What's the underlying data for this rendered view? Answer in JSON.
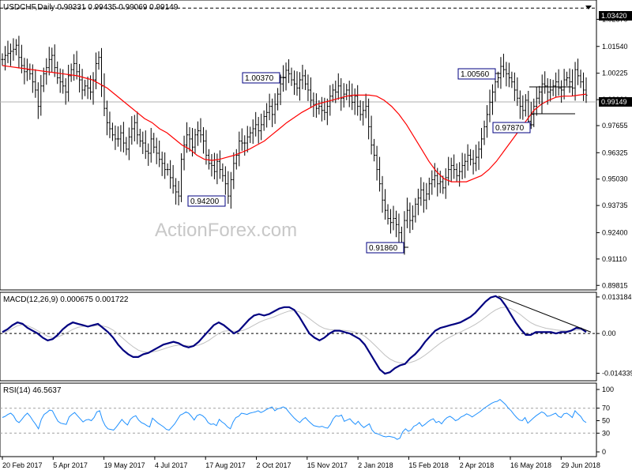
{
  "header": {
    "symbol_line": "USDCHF,Daily  0.99331 0.99435 0.99069 0.99149",
    "macd_label": "MACD(12,26,9) 0.000675 0.001722",
    "rsi_label": "RSI(14) 46.5637"
  },
  "watermark": "ActionForex.com",
  "colors": {
    "price": "#000000",
    "ma": "#ff0000",
    "macd": "#000080",
    "signal": "#c0c0c0",
    "rsi": "#1e90ff",
    "annotation_box": "#000080",
    "current_price_label_bg": "#000000"
  },
  "chart_data": [
    {
      "type": "ohlc",
      "name": "price",
      "y_ticks": [
        "1.03420",
        "1.02870",
        "1.01540",
        "1.00225",
        "0.99149",
        "0.98930",
        "0.97655",
        "0.96325",
        "0.95030",
        "0.93735",
        "0.92400",
        "0.91110",
        "0.89815"
      ],
      "ylim": [
        0.8967,
        1.0374
      ],
      "current_price": "0.99149",
      "resistance_level": 1.0342,
      "x_ticks": [
        "20 Feb 2017",
        "5 Apr 2017",
        "19 May 2017",
        "4 Jul 2017",
        "17 Aug 2017",
        "2 Oct 2017",
        "15 Nov 2017",
        "2 Jan 2018",
        "15 Feb 2018",
        "2 Apr 2018",
        "16 May 2018",
        "29 Jun 2018"
      ],
      "close_path": [
        1.009,
        1.011,
        1.012,
        1.013,
        1.014,
        1.016,
        1.01,
        1.006,
        1.003,
        1.004,
        1.002,
        0.998,
        0.994,
        0.986,
        0.996,
        1.002,
        1.005,
        1.009,
        1.011,
        1.005,
        1.0,
        0.998,
        0.996,
        0.993,
        1.001,
        1.004,
        1.007,
        1.003,
        0.999,
        0.994,
        0.996,
        0.995,
        0.993,
        0.999,
        1.007,
        1.01,
        0.996,
        0.985,
        0.978,
        0.975,
        0.972,
        0.97,
        0.97,
        0.973,
        0.968,
        0.965,
        0.971,
        0.975,
        0.978,
        0.972,
        0.969,
        0.968,
        0.964,
        0.963,
        0.97,
        0.966,
        0.963,
        0.96,
        0.958,
        0.955,
        0.955,
        0.951,
        0.947,
        0.944,
        0.942,
        0.96,
        0.967,
        0.972,
        0.97,
        0.966,
        0.972,
        0.974,
        0.972,
        0.969,
        0.962,
        0.958,
        0.957,
        0.954,
        0.959,
        0.955,
        0.952,
        0.948,
        0.942,
        0.95,
        0.958,
        0.962,
        0.969,
        0.968,
        0.968,
        0.971,
        0.973,
        0.975,
        0.977,
        0.974,
        0.977,
        0.981,
        0.983,
        0.986,
        0.982,
        0.987,
        0.992,
        0.997,
        1.0,
        1.0037,
        1.002,
        0.999,
        0.997,
        0.995,
        0.999,
        1.001,
        0.997,
        0.994,
        0.989,
        0.987,
        0.985,
        0.986,
        0.984,
        0.983,
        0.986,
        0.991,
        0.994,
        0.993,
        0.996,
        0.99,
        0.992,
        0.994,
        0.991,
        0.988,
        0.991,
        0.986,
        0.982,
        0.984,
        0.986,
        0.976,
        0.967,
        0.962,
        0.955,
        0.948,
        0.94,
        0.935,
        0.931,
        0.929,
        0.931,
        0.928,
        0.924,
        0.9186,
        0.93,
        0.935,
        0.93,
        0.932,
        0.938,
        0.941,
        0.945,
        0.94,
        0.943,
        0.948,
        0.95,
        0.952,
        0.948,
        0.949,
        0.946,
        0.951,
        0.955,
        0.957,
        0.955,
        0.952,
        0.954,
        0.957,
        0.959,
        0.962,
        0.96,
        0.958,
        0.961,
        0.965,
        0.97,
        0.976,
        0.982,
        0.988,
        0.993,
        0.998,
        1.0,
        1.0056,
        1.004,
        1.002,
        1.0,
        0.998,
        0.994,
        0.99,
        0.986,
        0.984,
        0.989,
        0.9787,
        0.982,
        0.986,
        0.99,
        0.993,
        0.997,
        0.996,
        0.993,
        0.994,
        0.996,
        0.998,
        0.995,
        0.994,
        0.999,
        1.0,
        0.998,
        0.995,
        1.004,
        1.001,
        0.998,
        0.994,
        0.99149
      ],
      "ma_path": [
        1.006,
        1.0055,
        1.005,
        1.0045,
        1.004,
        1.0035,
        1.003,
        1.0025,
        1.002,
        1.0015,
        1.001,
        1.0,
        0.999,
        0.997,
        0.995,
        0.992,
        0.989,
        0.986,
        0.983,
        0.98,
        0.978,
        0.975,
        0.973,
        0.97,
        0.967,
        0.965,
        0.962,
        0.96,
        0.9595,
        0.96,
        0.961,
        0.962,
        0.9635,
        0.965,
        0.967,
        0.969,
        0.972,
        0.975,
        0.978,
        0.9805,
        0.983,
        0.985,
        0.987,
        0.988,
        0.989,
        0.99,
        0.991,
        0.9915,
        0.9915,
        0.9915,
        0.991,
        0.989,
        0.986,
        0.982,
        0.977,
        0.971,
        0.965,
        0.959,
        0.954,
        0.9505,
        0.949,
        0.949,
        0.949,
        0.9505,
        0.952,
        0.955,
        0.959,
        0.964,
        0.969,
        0.974,
        0.979,
        0.984,
        0.987,
        0.989,
        0.9905,
        0.991,
        0.991,
        0.9915,
        0.992
      ]
    },
    {
      "type": "line",
      "name": "MACD",
      "y_ticks": [
        "0.013184",
        "0.00",
        "-0.014339"
      ],
      "ylim": [
        -0.0165,
        0.0143
      ],
      "zero_line": 0,
      "macd_path": [
        0.0005,
        0.0015,
        0.003,
        0.004,
        0.0035,
        0.002,
        0.001,
        0.0,
        -0.0015,
        -0.0025,
        -0.002,
        -0.0005,
        0.0015,
        0.003,
        0.004,
        0.0035,
        0.003,
        0.0025,
        0.003,
        0.0035,
        0.002,
        0.0005,
        -0.0015,
        -0.004,
        -0.006,
        -0.0075,
        -0.0085,
        -0.0085,
        -0.0075,
        -0.007,
        -0.006,
        -0.005,
        -0.004,
        -0.0035,
        -0.003,
        -0.0035,
        -0.0045,
        -0.005,
        -0.0045,
        -0.003,
        -0.001,
        0.001,
        0.003,
        0.004,
        0.003,
        0.0015,
        0.0,
        0.001,
        0.003,
        0.005,
        0.0065,
        0.007,
        0.0065,
        0.007,
        0.008,
        0.009,
        0.0095,
        0.0095,
        0.0085,
        0.006,
        0.003,
        0.0,
        -0.0015,
        -0.0025,
        -0.0015,
        0.0,
        0.001,
        0.001,
        0.0005,
        0.0,
        -0.001,
        -0.002,
        -0.004,
        -0.007,
        -0.01,
        -0.013,
        -0.0145,
        -0.014,
        -0.0125,
        -0.0115,
        -0.011,
        -0.009,
        -0.0075,
        -0.0055,
        -0.003,
        -0.001,
        0.001,
        0.002,
        0.0025,
        0.003,
        0.0035,
        0.004,
        0.005,
        0.006,
        0.0075,
        0.0095,
        0.0115,
        0.013,
        0.0135,
        0.0125,
        0.01,
        0.007,
        0.004,
        0.0015,
        -0.0005,
        -0.0005,
        0.0005,
        0.0005,
        0.0005,
        0.0005,
        0.0,
        0.0005,
        0.0005,
        0.001,
        0.002,
        0.0018,
        0.0005
      ],
      "signal_path": [
        0.0,
        0.0008,
        0.0018,
        0.0028,
        0.0032,
        0.0028,
        0.002,
        0.001,
        0.0,
        -0.001,
        -0.0015,
        -0.0012,
        -0.0005,
        0.0005,
        0.0015,
        0.0022,
        0.0026,
        0.0026,
        0.0027,
        0.0029,
        0.0027,
        0.0022,
        0.0012,
        -0.0002,
        -0.0018,
        -0.0034,
        -0.0048,
        -0.006,
        -0.0066,
        -0.0068,
        -0.0066,
        -0.0062,
        -0.0056,
        -0.005,
        -0.0045,
        -0.0042,
        -0.0042,
        -0.0044,
        -0.0045,
        -0.0042,
        -0.0035,
        -0.0025,
        -0.0012,
        0.0,
        0.0008,
        0.001,
        0.0008,
        0.0008,
        0.0012,
        0.002,
        0.003,
        0.004,
        0.0048,
        0.0054,
        0.006,
        0.0068,
        0.0075,
        0.0081,
        0.0083,
        0.0078,
        0.0068,
        0.0054,
        0.004,
        0.0027,
        0.0018,
        0.0014,
        0.0013,
        0.0012,
        0.0011,
        0.0009,
        0.0005,
        0.0,
        -0.001,
        -0.0025,
        -0.0042,
        -0.006,
        -0.0078,
        -0.0092,
        -0.0101,
        -0.0106,
        -0.0108,
        -0.0105,
        -0.0099,
        -0.009,
        -0.0078,
        -0.0064,
        -0.0049,
        -0.0035,
        -0.0023,
        -0.0012,
        -0.0003,
        0.0005,
        0.0014,
        0.0023,
        0.0033,
        0.0045,
        0.0059,
        0.0073,
        0.0085,
        0.0093,
        0.0095,
        0.009,
        0.008,
        0.0067,
        0.0052,
        0.0039,
        0.003,
        0.0024,
        0.0019,
        0.0016,
        0.0013,
        0.0011,
        0.001,
        0.001,
        0.0012,
        0.0013,
        0.0012
      ],
      "trendline": {
        "from": 0.0135,
        "to": 0.0005
      }
    },
    {
      "type": "line",
      "name": "RSI",
      "y_ticks": [
        "100",
        "70",
        "50",
        "30",
        "0"
      ],
      "ylim": [
        0,
        100
      ],
      "levels": [
        70,
        30
      ],
      "rsi_path": [
        55,
        57,
        60,
        62,
        58,
        50,
        47,
        52,
        58,
        62,
        57,
        50,
        44,
        37,
        52,
        60,
        63,
        67,
        66,
        57,
        49,
        46,
        45,
        44,
        56,
        60,
        63,
        58,
        53,
        48,
        51,
        52,
        50,
        55,
        64,
        66,
        51,
        42,
        37,
        36,
        35,
        40,
        46,
        52,
        47,
        43,
        52,
        56,
        58,
        51,
        47,
        45,
        42,
        40,
        54,
        50,
        46,
        43,
        40,
        36,
        35,
        40,
        45,
        52,
        59,
        61,
        64,
        62,
        57,
        51,
        58,
        60,
        58,
        54,
        47,
        44,
        45,
        42,
        52,
        48,
        45,
        40,
        37,
        48,
        55,
        57,
        62,
        61,
        60,
        62,
        63,
        64,
        66,
        63,
        65,
        68,
        70,
        72,
        66,
        69,
        70,
        72,
        70,
        64,
        59,
        54,
        50,
        47,
        52,
        55,
        50,
        46,
        42,
        41,
        40,
        41,
        39,
        38,
        44,
        53,
        58,
        57,
        59,
        49,
        51,
        53,
        48,
        44,
        49,
        43,
        39,
        42,
        45,
        35,
        30,
        29,
        27,
        25,
        24,
        25,
        24,
        23,
        20,
        22,
        32,
        37,
        33,
        35,
        41,
        43,
        47,
        41,
        44,
        48,
        51,
        53,
        47,
        49,
        45,
        51,
        55,
        57,
        54,
        50,
        52,
        56,
        58,
        61,
        59,
        56,
        59,
        62,
        65,
        69,
        72,
        75,
        78,
        80,
        81,
        84,
        80,
        76,
        70,
        66,
        60,
        55,
        51,
        50,
        55,
        46,
        50,
        54,
        58,
        61,
        64,
        62,
        57,
        58,
        60,
        62,
        57,
        55,
        61,
        62,
        59,
        55,
        66,
        61,
        57,
        50,
        47
      ]
    }
  ],
  "annotations": [
    {
      "text": "1.00370",
      "value": 1.0037
    },
    {
      "text": "0.94200",
      "value": 0.942
    },
    {
      "text": "0.91860",
      "value": 0.9186
    },
    {
      "text": "1.00560",
      "value": 1.0056
    },
    {
      "text": "0.97870",
      "value": 0.9787
    }
  ]
}
